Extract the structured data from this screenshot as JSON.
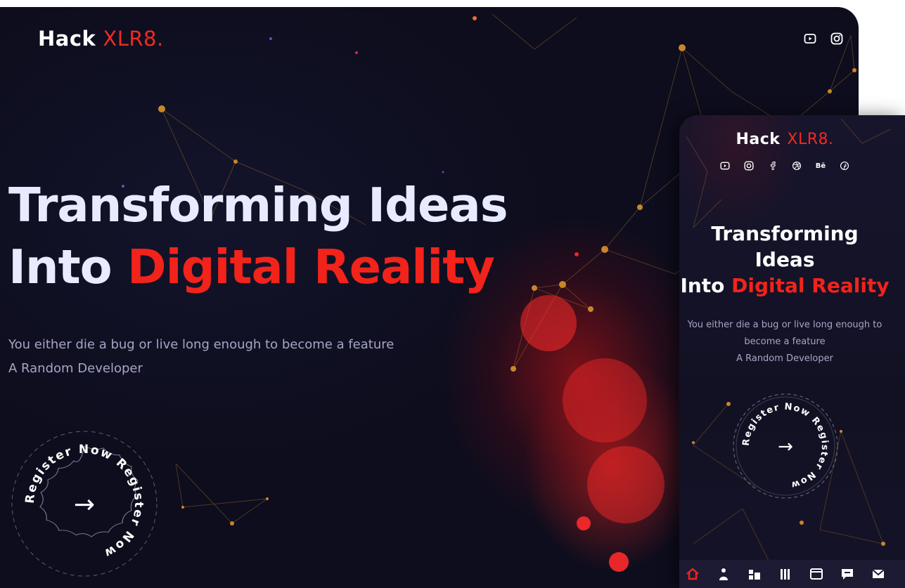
{
  "brand": {
    "name_white": "Hack",
    "name_red": "XLR8."
  },
  "desktop": {
    "social_icons": [
      "youtube-icon",
      "instagram-icon"
    ],
    "hero": {
      "line1": "Transforming Ideas",
      "line2_prefix": "Into ",
      "line2_red": "Digital Reality"
    },
    "quote": "You either die a bug or live long enough to become a feature",
    "quote_author": "A Random Developer",
    "cta": {
      "ring_text": "Register Now Register Now",
      "arrow": "→"
    }
  },
  "mobile": {
    "social_icons": [
      "youtube-icon",
      "instagram-icon",
      "facebook-icon",
      "dribbble-icon",
      "behance-icon",
      "pinterest-icon"
    ],
    "behance_label": "Bē",
    "hero": {
      "line1": "Transforming",
      "line2": "Ideas",
      "line3_prefix": "Into ",
      "line3_red": "Digital Reality"
    },
    "quote": "You either die a bug or live long enough to become a feature",
    "quote_author": "A Random Developer",
    "cta": {
      "ring_text": "Register Now Register Now",
      "arrow": "→"
    },
    "bottom_nav": [
      "home-icon",
      "user-icon",
      "dashboard-icon",
      "library-icon",
      "window-icon",
      "chat-icon",
      "mail-icon"
    ]
  },
  "colors": {
    "accent_red": "#f2231b",
    "background": "#0d0d1d",
    "muted_text": "#a7a5c6",
    "network_gold": "#c8862a"
  }
}
